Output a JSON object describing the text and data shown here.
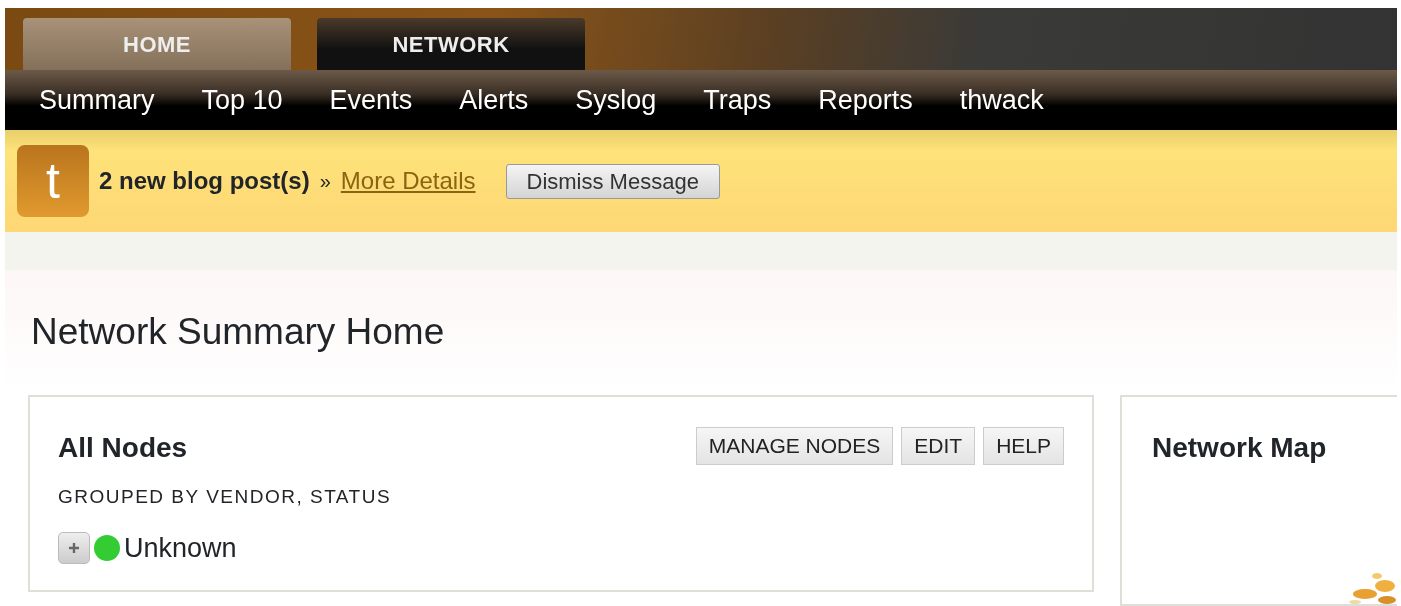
{
  "tabs": [
    {
      "label": "HOME",
      "selected": true
    },
    {
      "label": "NETWORK",
      "selected": false
    }
  ],
  "nav": [
    "Summary",
    "Top 10",
    "Events",
    "Alerts",
    "Syslog",
    "Traps",
    "Reports",
    "thwack"
  ],
  "notice": {
    "icon_letter": "t",
    "message": "2 new blog post(s)",
    "separator": "»",
    "link": "More Details",
    "button": "Dismiss Message"
  },
  "page_title": "Network Summary Home",
  "all_nodes": {
    "title": "All Nodes",
    "subtitle": "GROUPED BY VENDOR, STATUS",
    "buttons": [
      "MANAGE NODES",
      "EDIT",
      "HELP"
    ],
    "tree": [
      {
        "label": "Unknown",
        "expanded": false,
        "color": "#33cc33"
      }
    ]
  },
  "network_map": {
    "title": "Network Map",
    "kind": "picture"
  }
}
